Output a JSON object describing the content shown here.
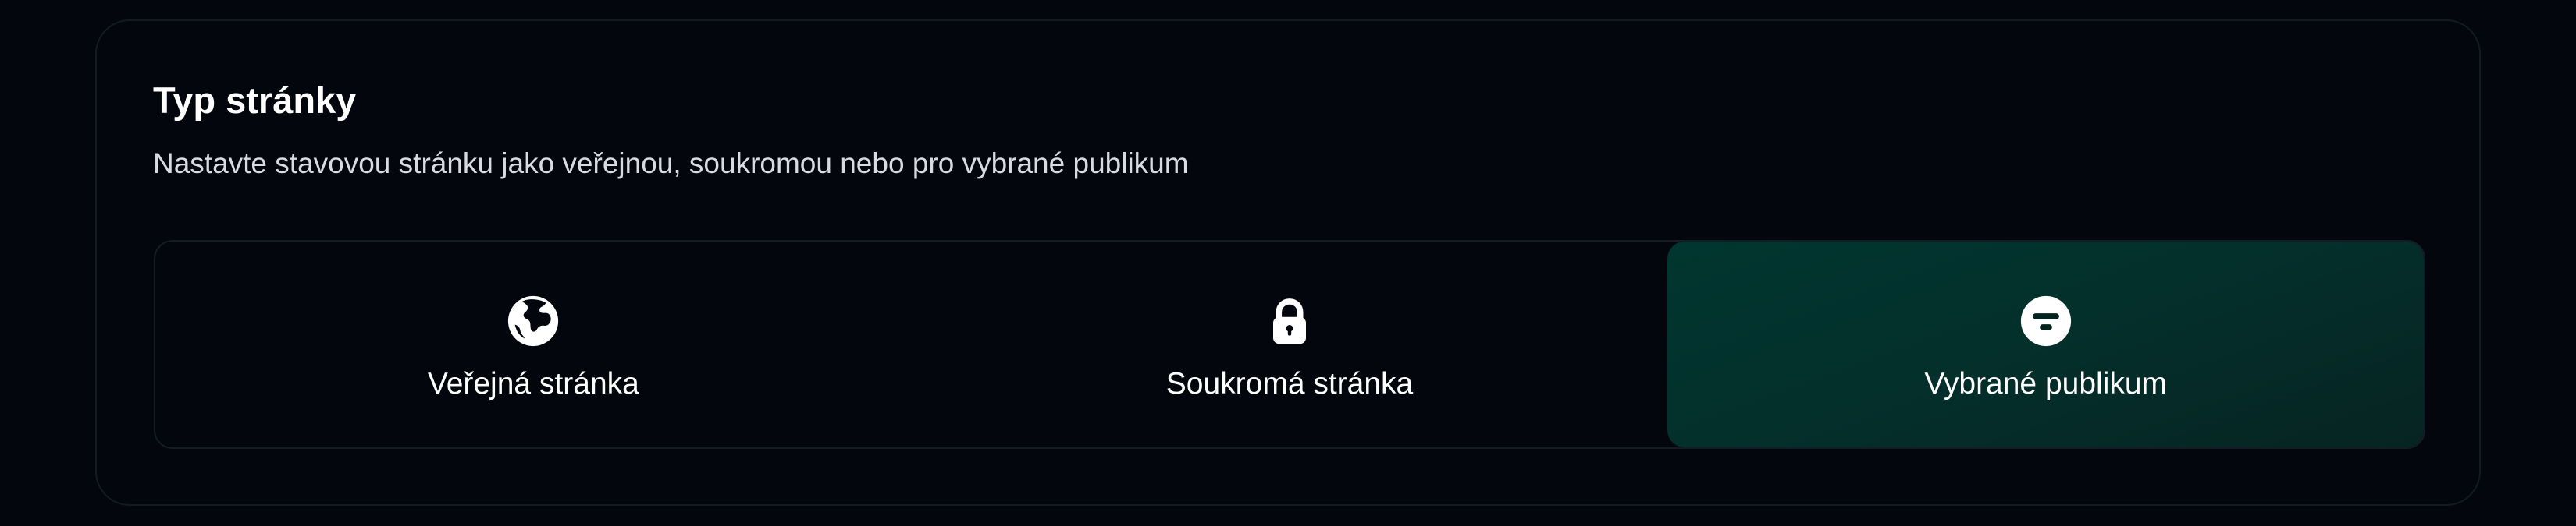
{
  "section": {
    "title": "Typ stránky",
    "subtitle": "Nastavte stavovou stránku jako veřejnou, soukromou nebo pro vybrané publikum"
  },
  "page_type_options": [
    {
      "label": "Veřejná stránka",
      "icon": "globe-icon",
      "selected": false
    },
    {
      "label": "Soukromá stránka",
      "icon": "lock-icon",
      "selected": false
    },
    {
      "label": "Vybrané publikum",
      "icon": "filter-icon",
      "selected": true
    }
  ],
  "colors": {
    "background": "#03060c",
    "border": "#141a24",
    "selected_background": "#00362f",
    "text": "#ffffff",
    "subtle_text": "#d8dbe1"
  }
}
